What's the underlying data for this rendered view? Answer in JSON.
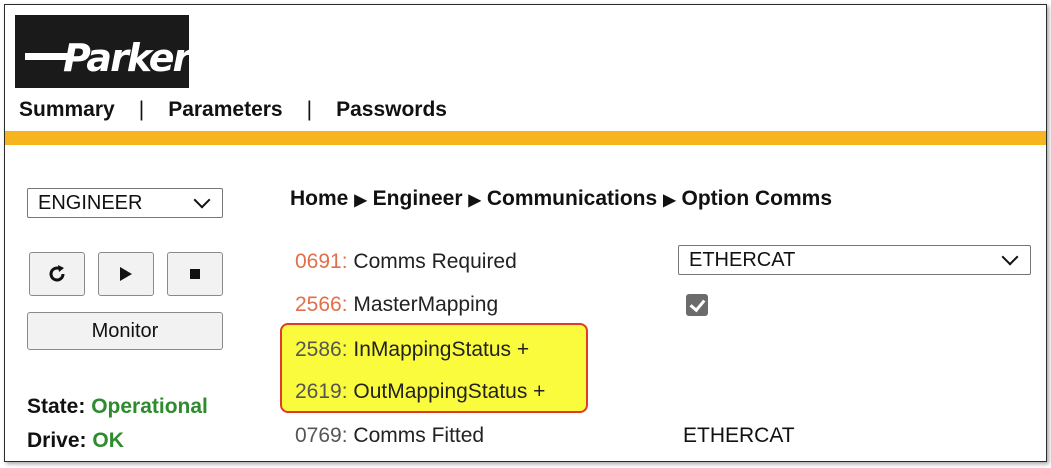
{
  "logo": {
    "text": "Parker"
  },
  "nav": {
    "items": [
      "Summary",
      "Parameters",
      "Passwords"
    ],
    "separator": "|"
  },
  "sidebar": {
    "role_select": {
      "value": "ENGINEER"
    },
    "toolbar": {
      "refresh_icon": "refresh-icon",
      "play_icon": "play-icon",
      "stop_icon": "stop-icon"
    },
    "monitor_label": "Monitor",
    "state_label": "State:",
    "state_value": "Operational",
    "drive_label": "Drive:",
    "drive_value": "OK"
  },
  "breadcrumb": [
    "Home",
    "Engineer",
    "Communications",
    "Option Comms"
  ],
  "breadcrumb_separator": "▶",
  "params": [
    {
      "code": "0691:",
      "label": "Comms Required",
      "value": "ETHERCAT",
      "type": "select"
    },
    {
      "code": "2566:",
      "label": "MasterMapping",
      "value": "checked",
      "type": "checkbox"
    },
    {
      "code": "2586:",
      "label": "InMappingStatus +",
      "highlighted": true
    },
    {
      "code": "2619:",
      "label": "OutMappingStatus +",
      "highlighted": true
    },
    {
      "code": "0769:",
      "label": "Comms Fitted",
      "value": "ETHERCAT",
      "type": "readonly"
    }
  ],
  "colors": {
    "accent_bar": "#f6b41f",
    "param_code": "#e0704a",
    "status_ok": "#2e8b2e",
    "highlight": "#f9fb3c",
    "highlight_border": "#e23a2a"
  }
}
